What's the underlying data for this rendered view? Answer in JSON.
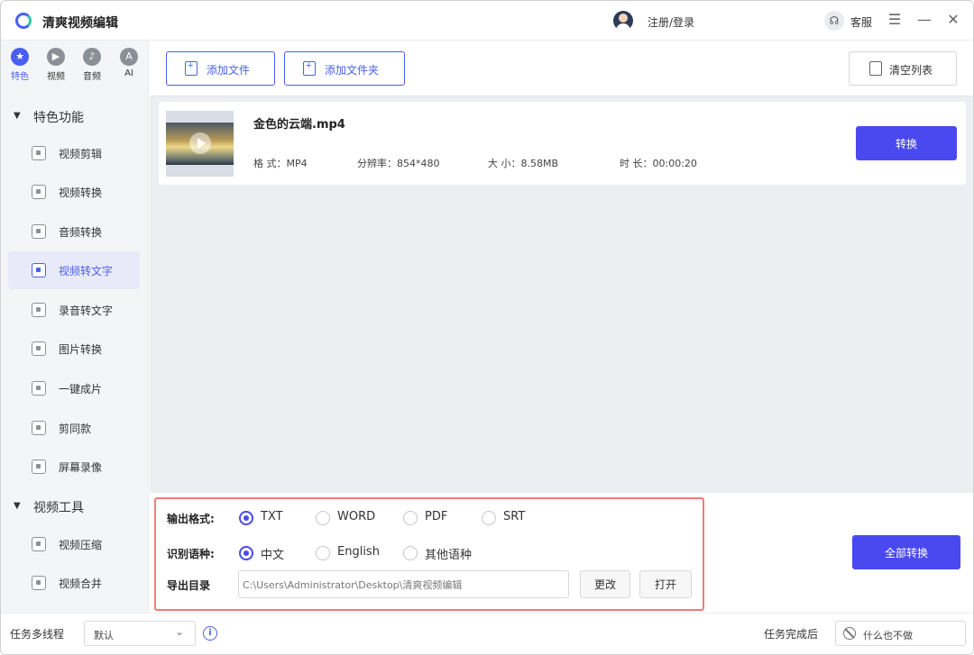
{
  "app": {
    "title": "清爽视频编辑",
    "login": "注册/登录",
    "service": "客服",
    "service_icon": "headset-icon"
  },
  "window": {
    "menu": "☰",
    "minimize": "—",
    "close": "✕"
  },
  "category_tabs": [
    {
      "label": "特色",
      "icon": "star-icon",
      "glyph": "★"
    },
    {
      "label": "视频",
      "icon": "video-icon",
      "glyph": "▶"
    },
    {
      "label": "音频",
      "icon": "audio-icon",
      "glyph": "♪"
    },
    {
      "label": "AI",
      "icon": "ai-icon",
      "glyph": "A"
    }
  ],
  "sections": [
    {
      "title": "特色功能",
      "items": [
        "视频剪辑",
        "视频转换",
        "音频转换",
        "视频转文字",
        "录音转文字",
        "图片转换",
        "一键成片",
        "剪同款",
        "屏幕录像"
      ]
    },
    {
      "title": "视频工具",
      "items": [
        "视频压缩",
        "视频合并"
      ]
    }
  ],
  "active_item": "视频转文字",
  "toolbar": {
    "add_file": "添加文件",
    "add_folder": "添加文件夹",
    "clear_list": "清空列表"
  },
  "file": {
    "name": "金色的云端.mp4",
    "format": "格  式：MP4",
    "resolution": "分辨率：854*480",
    "size": "大  小：8.58MB",
    "duration": "时  长：00:00:20",
    "convert": "转换"
  },
  "settings": {
    "output_format_label": "输出格式:",
    "formats": [
      "TXT",
      "WORD",
      "PDF",
      "SRT"
    ],
    "selected_format": "TXT",
    "language_label": "识别语种:",
    "languages": [
      "中文",
      "English",
      "其他语种"
    ],
    "selected_language": "中文",
    "export_label": "导出目录",
    "export_path": "C:\\Users\\Administrator\\Desktop\\清爽视频编辑",
    "change": "更改",
    "open": "打开",
    "convert_all": "全部转换"
  },
  "status": {
    "threads_label": "任务多线程",
    "threads_value": "默认",
    "info": "i",
    "after_label": "任务完成后",
    "after_value": "什么也不做"
  },
  "colors": {
    "accent": "#4a49f0",
    "highlight_border": "#f07b7b"
  }
}
